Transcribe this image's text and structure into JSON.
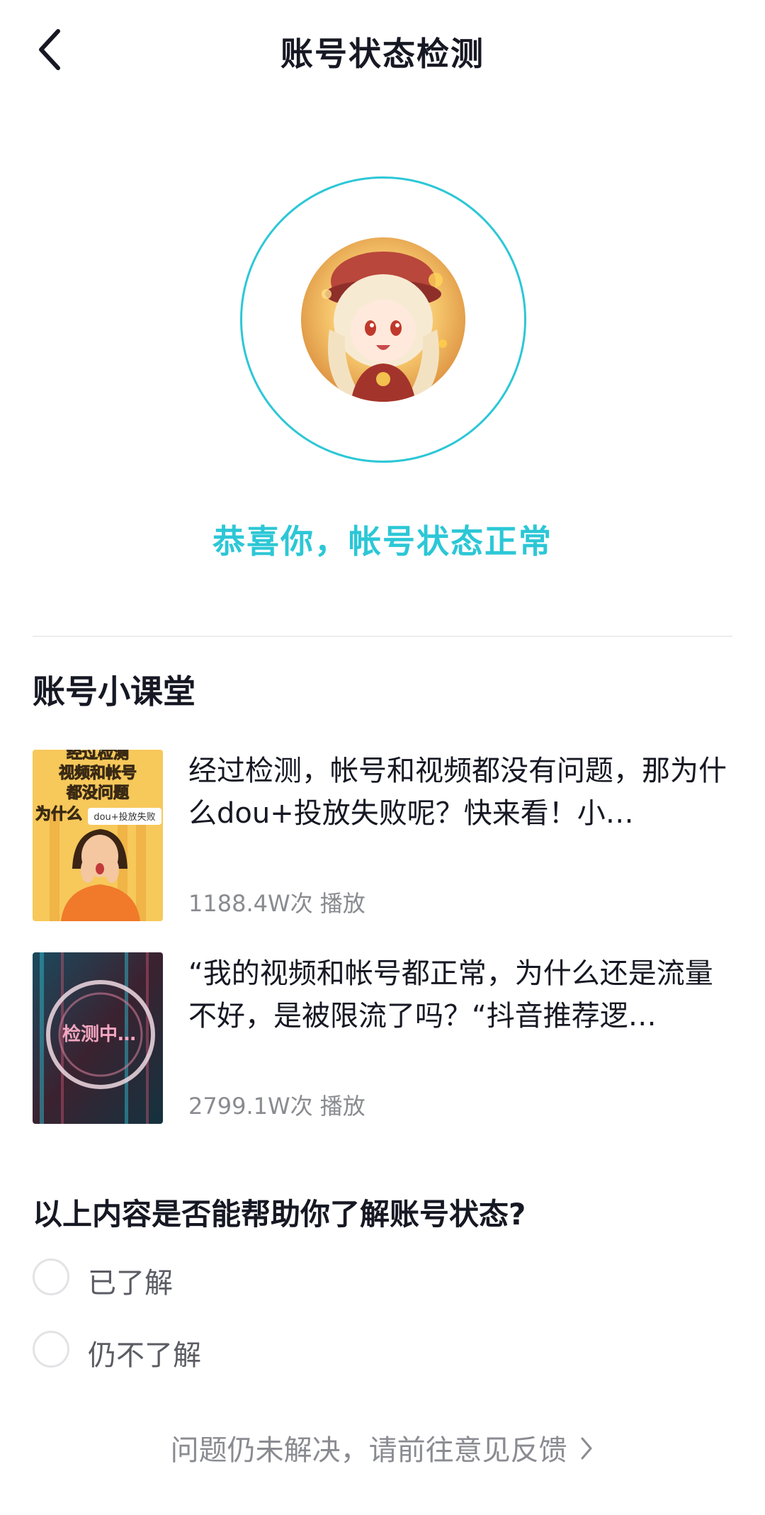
{
  "header": {
    "title": "账号状态检测"
  },
  "status": {
    "message": "恭喜你，帐号状态正常",
    "accent_color": "#2cc7d6"
  },
  "lesson": {
    "section_title": "账号小课堂",
    "videos": [
      {
        "title": "经过检测，帐号和视频都没有问题，那为什么dou+投放失败呢？快来看！小…",
        "plays": "1188.4W次 播放",
        "thumb_text": [
          "经过检测",
          "视频和帐号",
          "都没问题",
          "为什么",
          "dou+投放失败"
        ]
      },
      {
        "title": "“我的视频和帐号都正常，为什么还是流量不好，是被限流了吗？“抖音推荐逻…",
        "plays": "2799.1W次 播放",
        "thumb_text": [
          "检测中…"
        ]
      }
    ]
  },
  "survey": {
    "question": "以上内容是否能帮助你了解账号状态?",
    "options": [
      {
        "label": "已了解"
      },
      {
        "label": "仍不了解"
      }
    ]
  },
  "footer": {
    "feedback_text": "问题仍未解决，请前往意见反馈"
  }
}
